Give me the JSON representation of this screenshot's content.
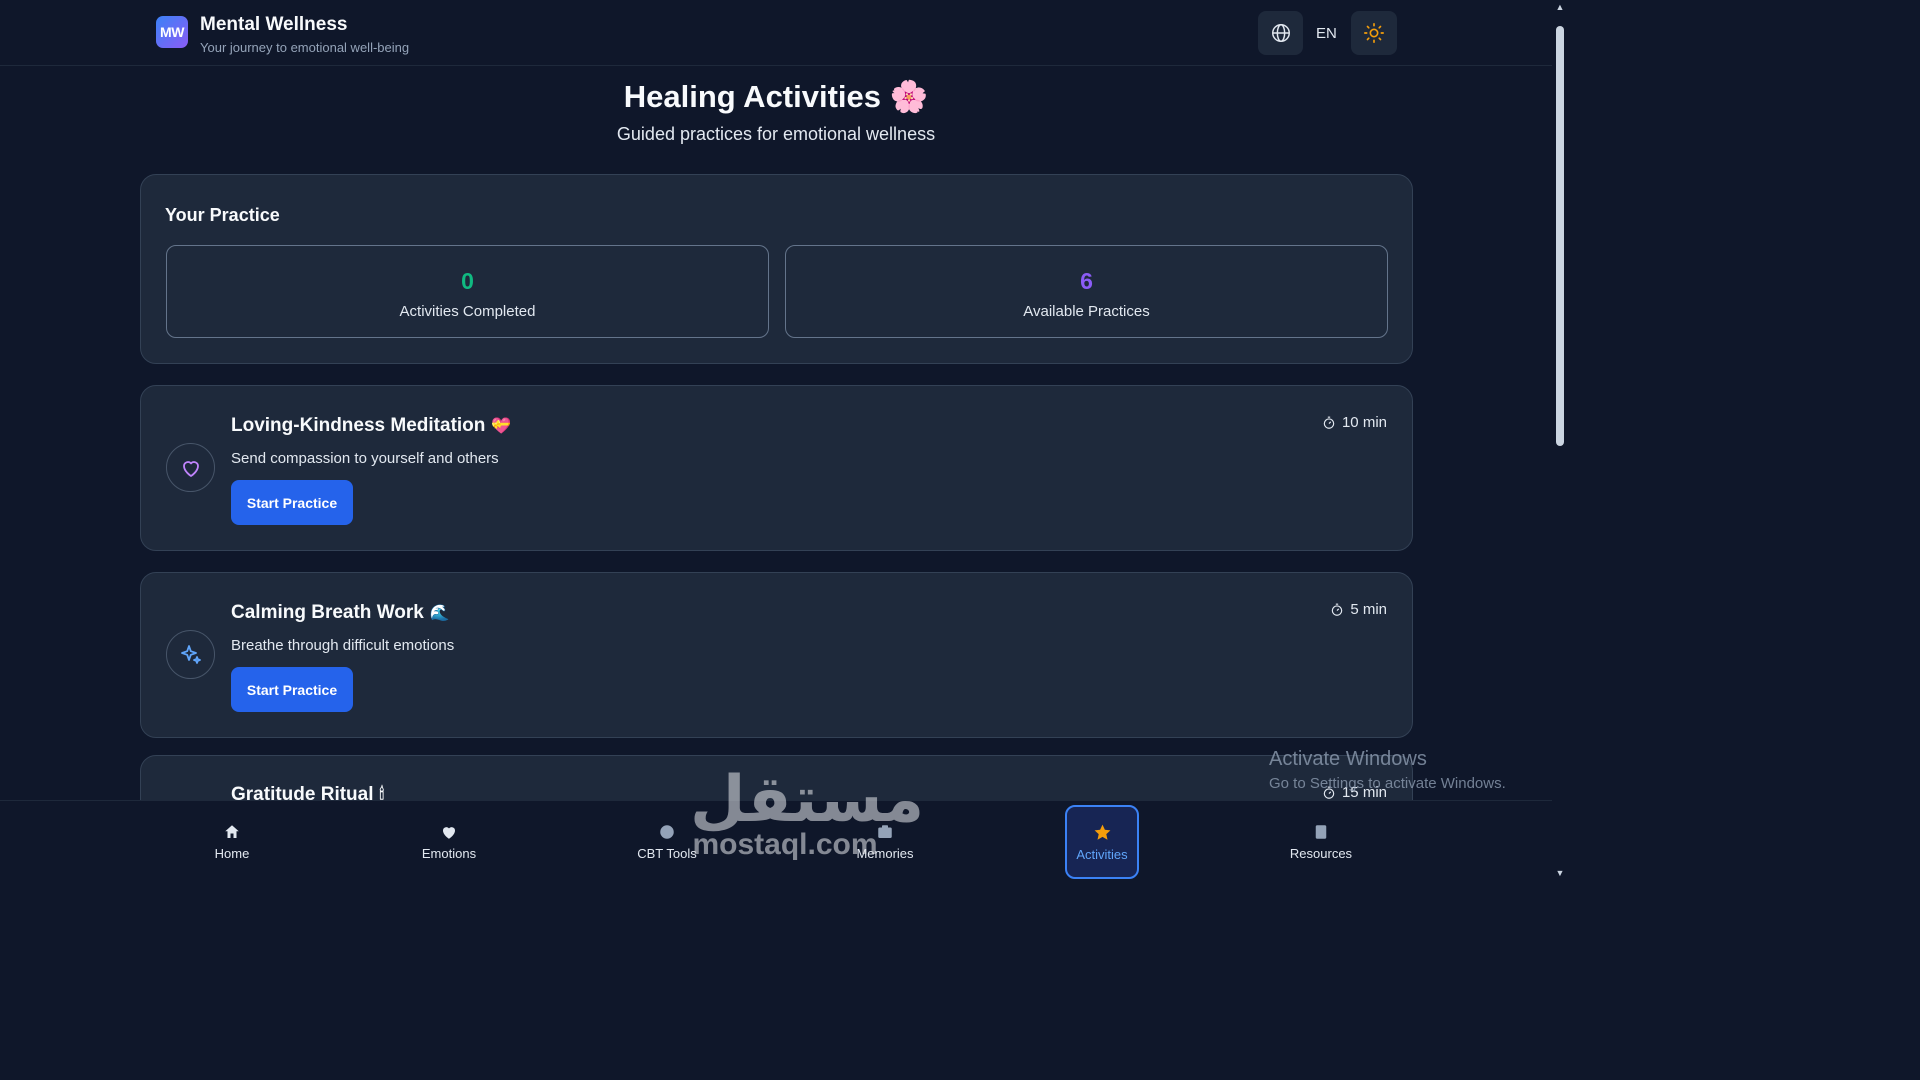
{
  "header": {
    "logo_text": "MW",
    "title": "Mental Wellness",
    "subtitle": "Your journey to emotional well-being",
    "language": "EN",
    "globe_icon": "globe-icon",
    "theme_icon": "sun-icon"
  },
  "page": {
    "title": "Healing Activities",
    "title_emoji": "🌸",
    "subtitle": "Guided practices for emotional wellness"
  },
  "practice": {
    "title": "Your Practice",
    "stats": [
      {
        "value": "0",
        "label": "Activities Completed",
        "color": "#10b981"
      },
      {
        "value": "6",
        "label": "Available Practices",
        "color": "#8b5cf6"
      }
    ]
  },
  "activities": [
    {
      "title": "Loving-Kindness Meditation",
      "emoji": "💝",
      "description": "Send compassion to yourself and others",
      "duration": "10 min",
      "button": "Start Practice",
      "icon": "heart-outline-icon",
      "icon_color": "#c084fc"
    },
    {
      "title": "Calming Breath Work",
      "emoji": "🌊",
      "description": "Breathe through difficult emotions",
      "duration": "5 min",
      "button": "Start Practice",
      "icon": "sparkles-icon",
      "icon_color": "#60a5fa"
    },
    {
      "title": "Gratitude Ritual",
      "emoji": "🕯",
      "description": "",
      "duration": "15 min",
      "button": "",
      "icon": "",
      "icon_color": ""
    }
  ],
  "nav": {
    "items": [
      {
        "label": "Home",
        "icon": "home-icon"
      },
      {
        "label": "Emotions",
        "icon": "heart-icon"
      },
      {
        "label": "CBT Tools",
        "icon": "brain-icon"
      },
      {
        "label": "Memories",
        "icon": "camera-icon"
      },
      {
        "label": "Activities",
        "icon": "star-icon",
        "active": true
      },
      {
        "label": "Resources",
        "icon": "book-icon"
      }
    ]
  },
  "overlays": {
    "windows_title": "Activate Windows",
    "windows_sub": "Go to Settings to activate Windows.",
    "watermark_arabic": "مستقل",
    "watermark_latin": "mostaql.com"
  }
}
